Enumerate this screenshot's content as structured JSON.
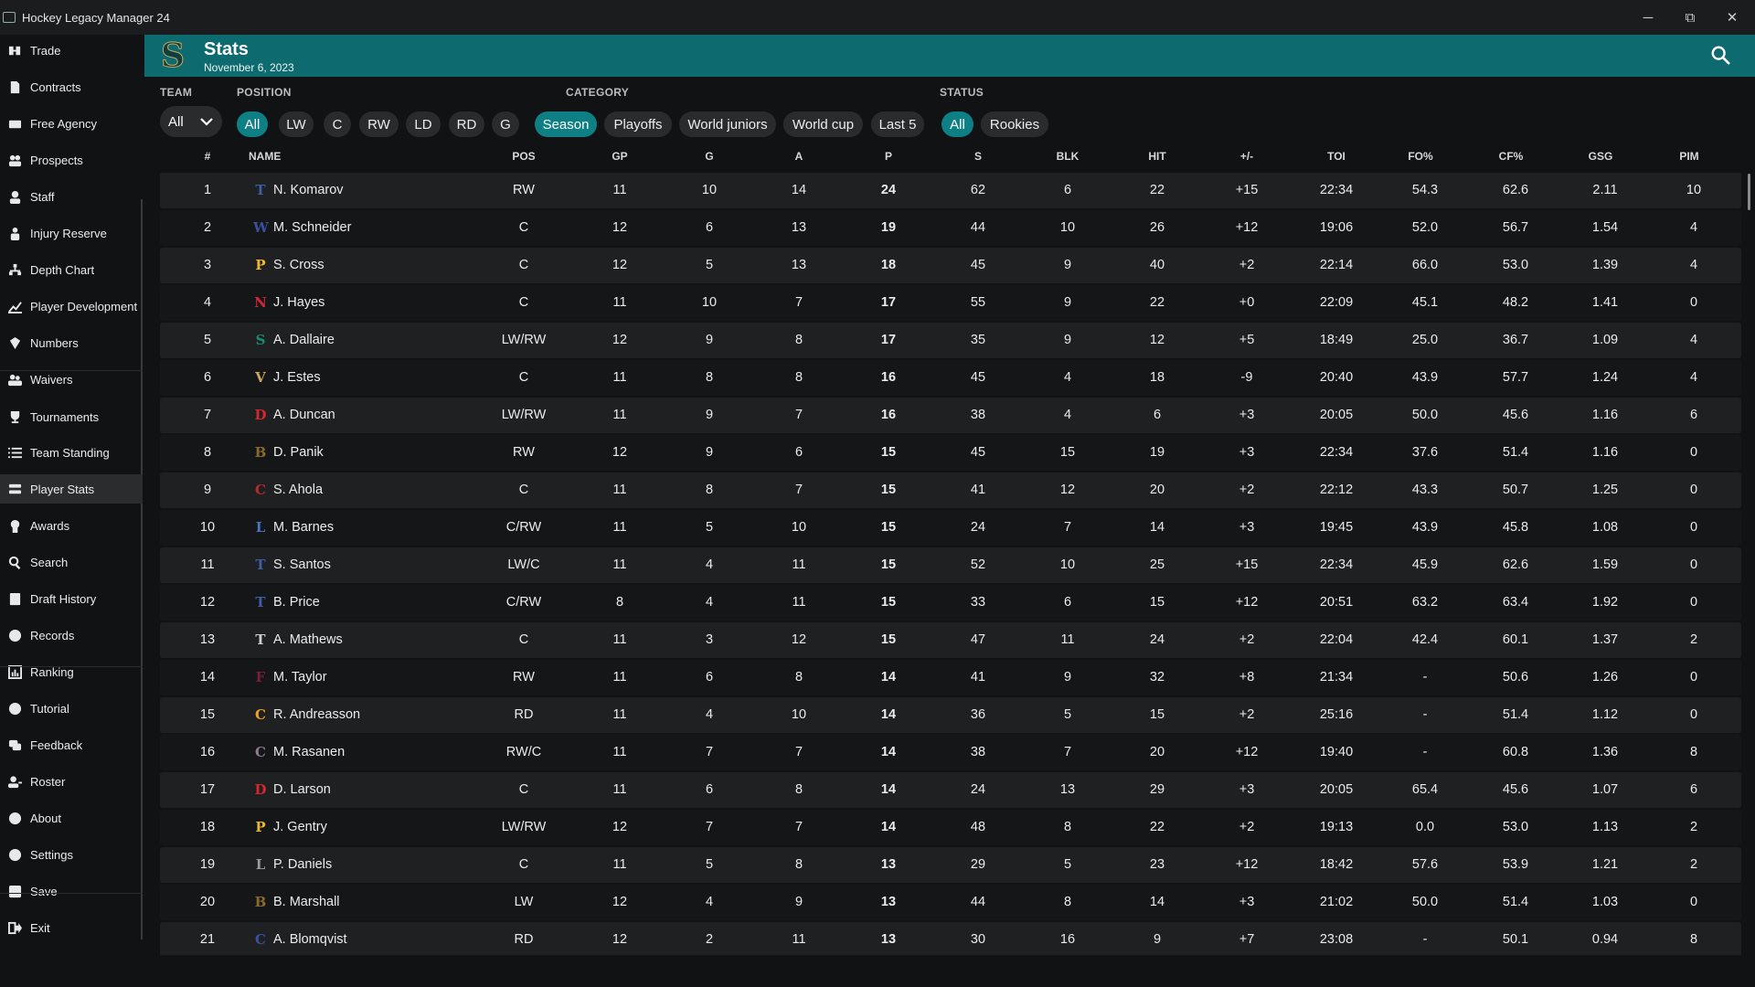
{
  "app": {
    "title": "Hockey Legacy Manager 24"
  },
  "window": {
    "min": "─",
    "max": "⧉",
    "close": "✕"
  },
  "sidebar": {
    "items": [
      {
        "label": "Trade",
        "icon": "trade-icon"
      },
      {
        "label": "Contracts",
        "icon": "contract-icon"
      },
      {
        "label": "Free Agency",
        "icon": "free-agency-icon"
      },
      {
        "label": "Prospects",
        "icon": "prospects-icon"
      },
      {
        "label": "Staff",
        "icon": "staff-icon"
      },
      {
        "label": "Injury Reserve",
        "icon": "injury-icon"
      },
      {
        "label": "Depth Chart",
        "icon": "depth-chart-icon"
      },
      {
        "label": "Player Development",
        "icon": "development-icon"
      },
      {
        "label": "Numbers",
        "icon": "numbers-icon"
      },
      {
        "label": "Waivers",
        "icon": "waivers-icon"
      },
      {
        "label": "Tournaments",
        "icon": "trophy-icon"
      },
      {
        "label": "Team Standing",
        "icon": "list-icon"
      },
      {
        "label": "Player Stats",
        "icon": "stats-icon",
        "active": true
      },
      {
        "label": "Awards",
        "icon": "award-icon"
      },
      {
        "label": "Search",
        "icon": "search-icon"
      },
      {
        "label": "Draft History",
        "icon": "draft-icon"
      },
      {
        "label": "Records",
        "icon": "records-icon"
      },
      {
        "label": "Ranking",
        "icon": "ranking-icon"
      },
      {
        "label": "Tutorial",
        "icon": "help-icon"
      },
      {
        "label": "Feedback",
        "icon": "feedback-icon"
      },
      {
        "label": "Roster",
        "icon": "roster-icon"
      },
      {
        "label": "About",
        "icon": "info-icon"
      },
      {
        "label": "Settings",
        "icon": "gear-icon"
      },
      {
        "label": "Save",
        "icon": "save-icon"
      },
      {
        "label": "Exit",
        "icon": "exit-icon"
      }
    ]
  },
  "header": {
    "title": "Stats",
    "date": "November 6, 2023",
    "accent": "#0d6b6f"
  },
  "filters": {
    "team_label": "TEAM",
    "team_value": "All",
    "position_label": "POSITION",
    "positions": [
      {
        "label": "All",
        "active": true
      },
      {
        "label": "LW"
      },
      {
        "label": "C"
      },
      {
        "label": "RW"
      },
      {
        "label": "LD"
      },
      {
        "label": "RD"
      },
      {
        "label": "G"
      }
    ],
    "category_label": "CATEGORY",
    "categories": [
      {
        "label": "Season",
        "active": true
      },
      {
        "label": "Playoffs"
      },
      {
        "label": "World juniors"
      },
      {
        "label": "World cup"
      },
      {
        "label": "Last 5"
      }
    ],
    "status_label": "STATUS",
    "statuses": [
      {
        "label": "All",
        "active": true
      },
      {
        "label": "Rookies"
      }
    ]
  },
  "table": {
    "columns": [
      "#",
      "NAME",
      "POS",
      "GP",
      "G",
      "A",
      "P",
      "S",
      "BLK",
      "HIT",
      "+/-",
      "TOI",
      "FO%",
      "CF%",
      "GSG",
      "PIM"
    ],
    "rows": [
      {
        "rank": "1",
        "team": {
          "letter": "T",
          "color": "#3d5fa8"
        },
        "name": "N. Komarov",
        "pos": "RW",
        "gp": "11",
        "g": "10",
        "a": "14",
        "p": "24",
        "s": "62",
        "blk": "6",
        "hit": "22",
        "pm": "+15",
        "toi": "22:34",
        "fo": "54.3",
        "cf": "62.6",
        "gsg": "2.11",
        "pim": "10"
      },
      {
        "rank": "2",
        "team": {
          "letter": "W",
          "color": "#3a4fa0"
        },
        "name": "M. Schneider",
        "pos": "C",
        "gp": "12",
        "g": "6",
        "a": "13",
        "p": "19",
        "s": "44",
        "blk": "10",
        "hit": "26",
        "pm": "+12",
        "toi": "19:06",
        "fo": "52.0",
        "cf": "56.7",
        "gsg": "1.54",
        "pim": "4"
      },
      {
        "rank": "3",
        "team": {
          "letter": "P",
          "color": "#f0b82d"
        },
        "name": "S. Cross",
        "pos": "C",
        "gp": "12",
        "g": "5",
        "a": "13",
        "p": "18",
        "s": "45",
        "blk": "9",
        "hit": "40",
        "pm": "+2",
        "toi": "22:14",
        "fo": "66.0",
        "cf": "53.0",
        "gsg": "1.39",
        "pim": "4"
      },
      {
        "rank": "4",
        "team": {
          "letter": "N",
          "color": "#d2263a"
        },
        "name": "J. Hayes",
        "pos": "C",
        "gp": "11",
        "g": "10",
        "a": "7",
        "p": "17",
        "s": "55",
        "blk": "9",
        "hit": "22",
        "pm": "+0",
        "toi": "22:09",
        "fo": "45.1",
        "cf": "48.2",
        "gsg": "1.41",
        "pim": "0"
      },
      {
        "rank": "5",
        "team": {
          "letter": "S",
          "color": "#1c8a6e"
        },
        "name": "A. Dallaire",
        "pos": "LW/RW",
        "gp": "12",
        "g": "9",
        "a": "8",
        "p": "17",
        "s": "35",
        "blk": "9",
        "hit": "12",
        "pm": "+5",
        "toi": "18:49",
        "fo": "25.0",
        "cf": "36.7",
        "gsg": "1.09",
        "pim": "4"
      },
      {
        "rank": "6",
        "team": {
          "letter": "V",
          "color": "#c9a65a"
        },
        "name": "J. Estes",
        "pos": "C",
        "gp": "11",
        "g": "8",
        "a": "8",
        "p": "16",
        "s": "45",
        "blk": "4",
        "hit": "18",
        "pm": "-9",
        "toi": "20:40",
        "fo": "43.9",
        "cf": "57.7",
        "gsg": "1.24",
        "pim": "4"
      },
      {
        "rank": "7",
        "team": {
          "letter": "D",
          "color": "#d8262e"
        },
        "name": "A. Duncan",
        "pos": "LW/RW",
        "gp": "11",
        "g": "9",
        "a": "7",
        "p": "16",
        "s": "38",
        "blk": "4",
        "hit": "6",
        "pm": "+3",
        "toi": "20:05",
        "fo": "50.0",
        "cf": "45.6",
        "gsg": "1.16",
        "pim": "6"
      },
      {
        "rank": "8",
        "team": {
          "letter": "B",
          "color": "#8a6a2a"
        },
        "name": "D. Panik",
        "pos": "RW",
        "gp": "12",
        "g": "9",
        "a": "6",
        "p": "15",
        "s": "45",
        "blk": "15",
        "hit": "19",
        "pm": "+3",
        "toi": "22:34",
        "fo": "37.6",
        "cf": "51.4",
        "gsg": "1.16",
        "pim": "0"
      },
      {
        "rank": "9",
        "team": {
          "letter": "C",
          "color": "#b52a2a"
        },
        "name": "S. Ahola",
        "pos": "C",
        "gp": "11",
        "g": "8",
        "a": "7",
        "p": "15",
        "s": "41",
        "blk": "12",
        "hit": "20",
        "pm": "+2",
        "toi": "22:12",
        "fo": "43.3",
        "cf": "50.7",
        "gsg": "1.25",
        "pim": "0"
      },
      {
        "rank": "10",
        "team": {
          "letter": "L",
          "color": "#4a74c4"
        },
        "name": "M. Barnes",
        "pos": "C/RW",
        "gp": "11",
        "g": "5",
        "a": "10",
        "p": "15",
        "s": "24",
        "blk": "7",
        "hit": "14",
        "pm": "+3",
        "toi": "19:45",
        "fo": "43.9",
        "cf": "45.8",
        "gsg": "1.08",
        "pim": "0"
      },
      {
        "rank": "11",
        "team": {
          "letter": "T",
          "color": "#3d5fa8"
        },
        "name": "S. Santos",
        "pos": "LW/C",
        "gp": "11",
        "g": "4",
        "a": "11",
        "p": "15",
        "s": "52",
        "blk": "10",
        "hit": "25",
        "pm": "+15",
        "toi": "22:34",
        "fo": "45.9",
        "cf": "62.6",
        "gsg": "1.59",
        "pim": "0"
      },
      {
        "rank": "12",
        "team": {
          "letter": "T",
          "color": "#3d5fa8"
        },
        "name": "B. Price",
        "pos": "C/RW",
        "gp": "8",
        "g": "4",
        "a": "11",
        "p": "15",
        "s": "33",
        "blk": "6",
        "hit": "15",
        "pm": "+12",
        "toi": "20:51",
        "fo": "63.2",
        "cf": "63.4",
        "gsg": "1.92",
        "pim": "0"
      },
      {
        "rank": "13",
        "team": {
          "letter": "T",
          "color": "#cfcfcf"
        },
        "name": "A. Mathews",
        "pos": "C",
        "gp": "11",
        "g": "3",
        "a": "12",
        "p": "15",
        "s": "47",
        "blk": "11",
        "hit": "24",
        "pm": "+2",
        "toi": "22:04",
        "fo": "42.4",
        "cf": "60.1",
        "gsg": "1.37",
        "pim": "2"
      },
      {
        "rank": "14",
        "team": {
          "letter": "F",
          "color": "#7a1f3a"
        },
        "name": "M. Taylor",
        "pos": "RW",
        "gp": "11",
        "g": "6",
        "a": "8",
        "p": "14",
        "s": "41",
        "blk": "9",
        "hit": "32",
        "pm": "+8",
        "toi": "21:34",
        "fo": "-",
        "cf": "50.6",
        "gsg": "1.26",
        "pim": "0"
      },
      {
        "rank": "15",
        "team": {
          "letter": "C",
          "color": "#f0a01e"
        },
        "name": "R. Andreasson",
        "pos": "RD",
        "gp": "11",
        "g": "4",
        "a": "10",
        "p": "14",
        "s": "36",
        "blk": "5",
        "hit": "15",
        "pm": "+2",
        "toi": "25:16",
        "fo": "-",
        "cf": "51.4",
        "gsg": "1.12",
        "pim": "0"
      },
      {
        "rank": "16",
        "team": {
          "letter": "C",
          "color": "#8a7a8a"
        },
        "name": "M. Rasanen",
        "pos": "RW/C",
        "gp": "11",
        "g": "7",
        "a": "7",
        "p": "14",
        "s": "38",
        "blk": "7",
        "hit": "20",
        "pm": "+12",
        "toi": "19:40",
        "fo": "-",
        "cf": "60.8",
        "gsg": "1.36",
        "pim": "8"
      },
      {
        "rank": "17",
        "team": {
          "letter": "D",
          "color": "#d8262e"
        },
        "name": "D. Larson",
        "pos": "C",
        "gp": "11",
        "g": "6",
        "a": "8",
        "p": "14",
        "s": "24",
        "blk": "13",
        "hit": "29",
        "pm": "+3",
        "toi": "20:05",
        "fo": "65.4",
        "cf": "45.6",
        "gsg": "1.07",
        "pim": "6"
      },
      {
        "rank": "18",
        "team": {
          "letter": "P",
          "color": "#f0b82d"
        },
        "name": "J. Gentry",
        "pos": "LW/RW",
        "gp": "12",
        "g": "7",
        "a": "7",
        "p": "14",
        "s": "48",
        "blk": "8",
        "hit": "22",
        "pm": "+2",
        "toi": "19:13",
        "fo": "0.0",
        "cf": "53.0",
        "gsg": "1.13",
        "pim": "2"
      },
      {
        "rank": "19",
        "team": {
          "letter": "L",
          "color": "#9a9a9a"
        },
        "name": "P. Daniels",
        "pos": "C",
        "gp": "11",
        "g": "5",
        "a": "8",
        "p": "13",
        "s": "29",
        "blk": "5",
        "hit": "23",
        "pm": "+12",
        "toi": "18:42",
        "fo": "57.6",
        "cf": "53.9",
        "gsg": "1.21",
        "pim": "2"
      },
      {
        "rank": "20",
        "team": {
          "letter": "B",
          "color": "#8a6a2a"
        },
        "name": "B. Marshall",
        "pos": "LW",
        "gp": "12",
        "g": "4",
        "a": "9",
        "p": "13",
        "s": "44",
        "blk": "8",
        "hit": "14",
        "pm": "+3",
        "toi": "21:02",
        "fo": "50.0",
        "cf": "51.4",
        "gsg": "1.03",
        "pim": "0"
      },
      {
        "rank": "21",
        "team": {
          "letter": "C",
          "color": "#3a4fa0"
        },
        "name": "A. Blomqvist",
        "pos": "RD",
        "gp": "12",
        "g": "2",
        "a": "11",
        "p": "13",
        "s": "30",
        "blk": "16",
        "hit": "9",
        "pm": "+7",
        "toi": "23:08",
        "fo": "-",
        "cf": "50.1",
        "gsg": "0.94",
        "pim": "8"
      }
    ]
  }
}
